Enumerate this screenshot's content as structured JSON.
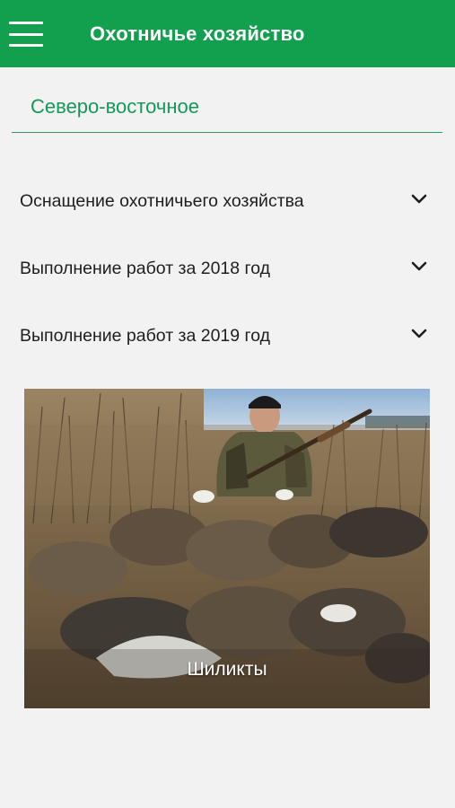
{
  "header": {
    "title": "Охотничье хозяйство",
    "menu_icon": "hamburger-icon",
    "background": "#12a04f"
  },
  "region": {
    "selected": "Северо-восточное",
    "accent": "#15995a"
  },
  "accordion": [
    {
      "label": "Оснащение охотничьего хозяйства",
      "icon": "chevron-down-icon"
    },
    {
      "label": "Выполнение работ за 2018 год",
      "icon": "chevron-down-icon"
    },
    {
      "label": "Выполнение работ за 2019 год",
      "icon": "chevron-down-icon"
    }
  ],
  "photo": {
    "caption": "Шиликты"
  }
}
